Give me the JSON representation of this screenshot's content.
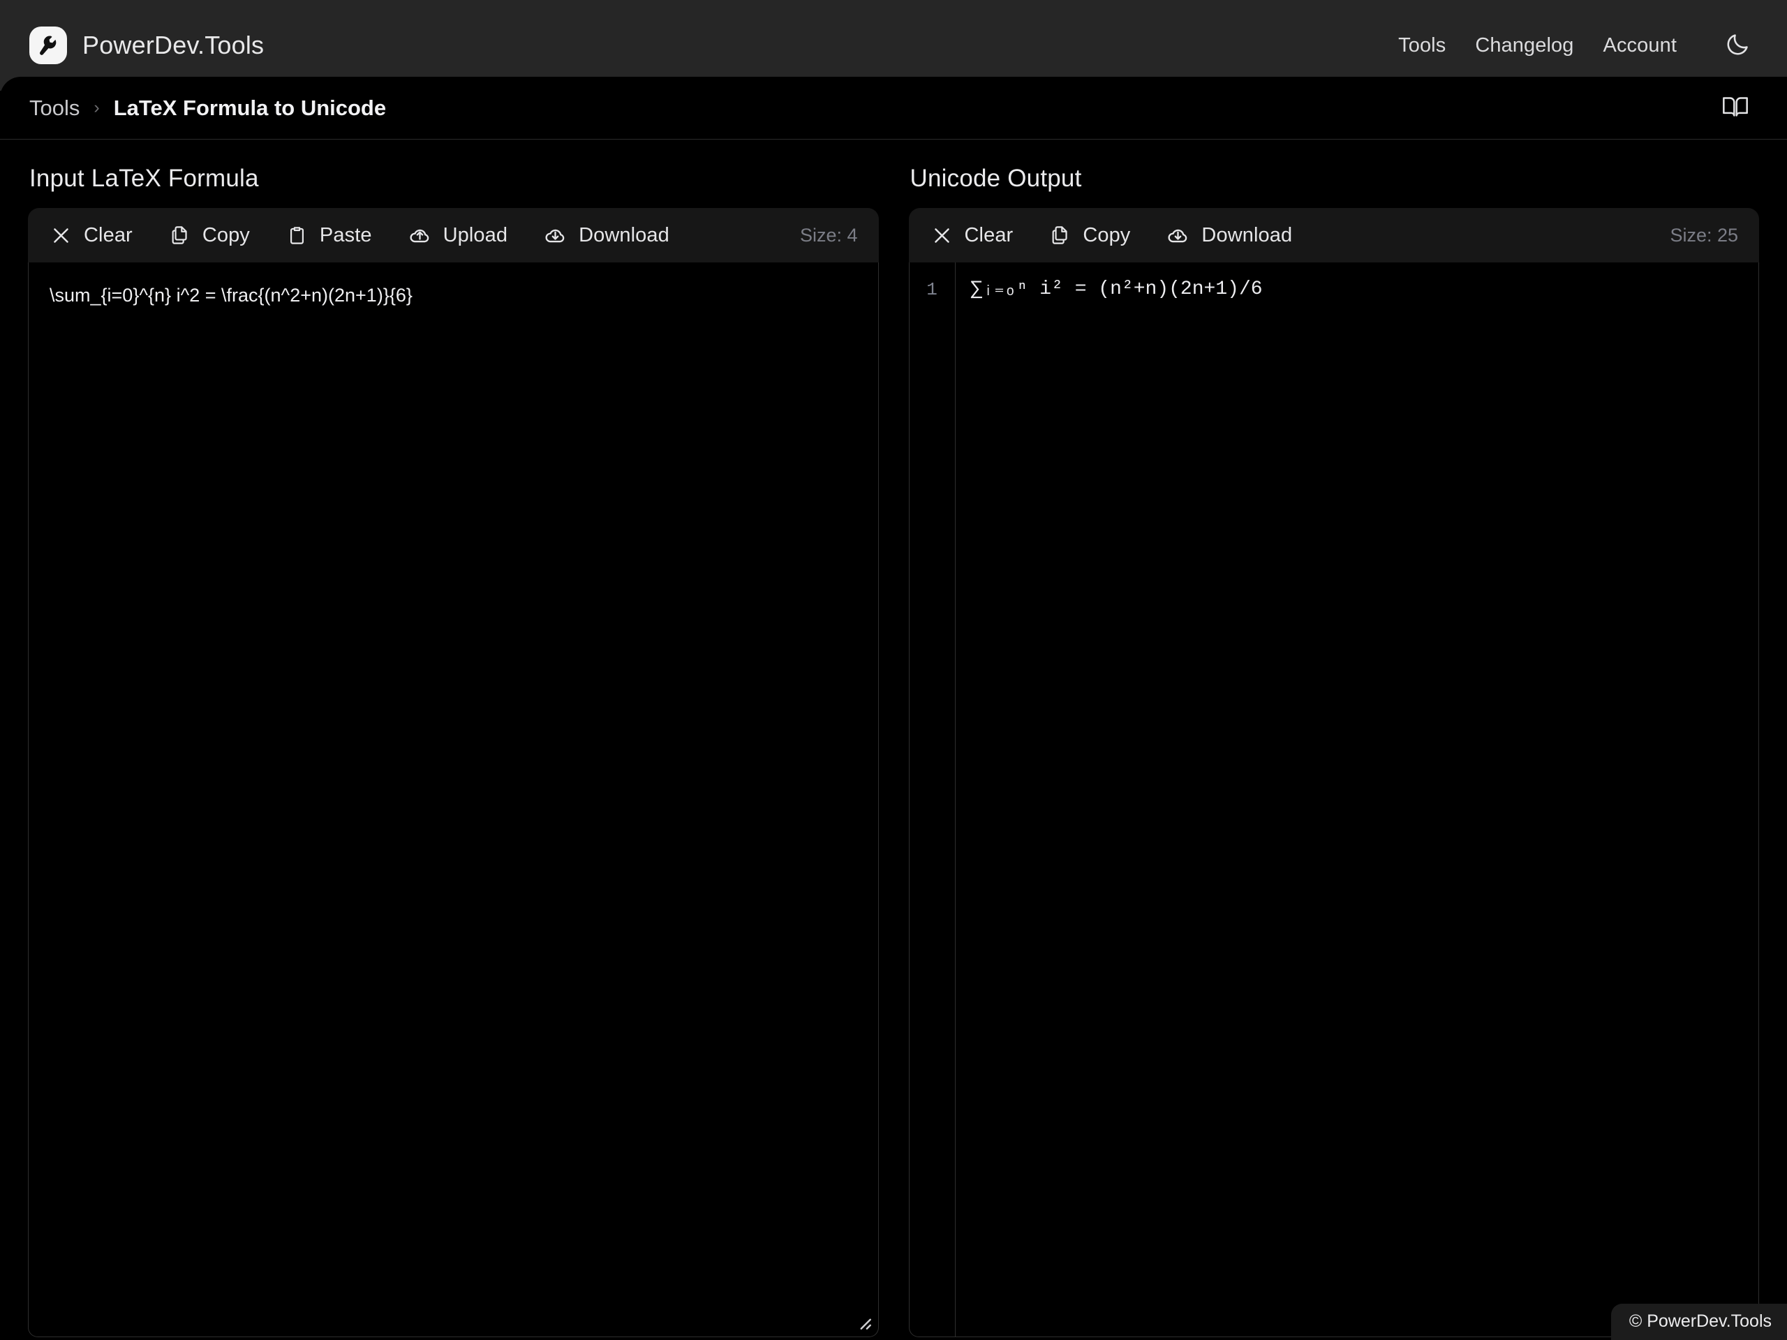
{
  "header": {
    "brand_name": "PowerDev.Tools",
    "logo_icon": "wrench-logo-icon",
    "nav": [
      {
        "label": "Tools",
        "name": "nav-tools"
      },
      {
        "label": "Changelog",
        "name": "nav-changelog"
      },
      {
        "label": "Account",
        "name": "nav-account"
      }
    ],
    "theme_toggle_icon": "moon-icon"
  },
  "breadcrumb": {
    "root": "Tools",
    "separator": "›",
    "current": "LaTeX Formula to Unicode",
    "docs_icon": "open-book-icon"
  },
  "input_panel": {
    "title": "Input LaTeX Formula",
    "toolbar": {
      "clear": "Clear",
      "copy": "Copy",
      "paste": "Paste",
      "upload": "Upload",
      "download": "Download",
      "size_label": "Size: 4"
    },
    "value": "\\sum_{i=0}^{n} i^2 = \\frac{(n^2+n)(2n+1)}{6}",
    "placeholder": ""
  },
  "output_panel": {
    "title": "Unicode Output",
    "toolbar": {
      "clear": "Clear",
      "copy": "Copy",
      "download": "Download",
      "size_label": "Size: 25"
    },
    "line_number": "1",
    "value": "∑ᵢ₌ₒⁿ i² = (n²+n)(2n+1)/6"
  },
  "footer": {
    "copyright": "© PowerDev.Tools"
  },
  "colors": {
    "topbar_bg": "#262626",
    "page_bg": "#000000",
    "toolbar_bg": "#171717",
    "border": "#2e2e2e",
    "text_primary": "#ededf0",
    "text_muted": "#7b7d86"
  }
}
